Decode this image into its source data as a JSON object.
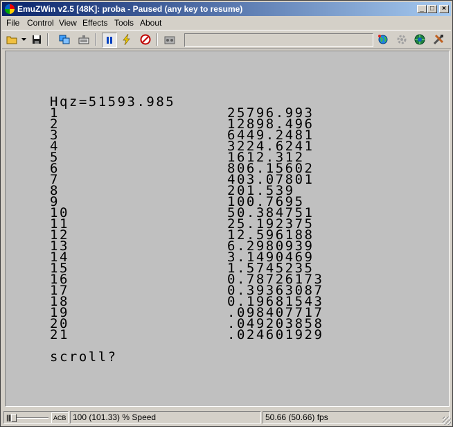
{
  "window": {
    "title": "EmuZWin v2.5 [48K]: proba - Paused (any key to resume)",
    "controls": {
      "minimize": "_",
      "maximize": "□",
      "close": "×"
    }
  },
  "menu": [
    "File",
    "Control",
    "View",
    "Effects",
    "Tools",
    "About"
  ],
  "toolbar": {
    "icons": [
      "open-folder-icon",
      "dropdown-arrow-icon",
      "save-disk-icon",
      "snapshot-icon",
      "keyboard-icon",
      "pause-icon",
      "lightning-icon",
      "no-sound-icon",
      "tape-icon",
      "speed-field",
      "web-icon",
      "gear-icon",
      "globe-icon",
      "tools-icon"
    ]
  },
  "screen": {
    "header": "Hqz=51593.985",
    "rows": [
      {
        "n": "1",
        "v": "25796.993"
      },
      {
        "n": "2",
        "v": "12898.496"
      },
      {
        "n": "3",
        "v": "6449.2481"
      },
      {
        "n": "4",
        "v": "3224.6241"
      },
      {
        "n": "5",
        "v": "1612.312"
      },
      {
        "n": "6",
        "v": "806.15602"
      },
      {
        "n": "7",
        "v": "403.07801"
      },
      {
        "n": "8",
        "v": "201.539"
      },
      {
        "n": "9",
        "v": "100.7695"
      },
      {
        "n": "10",
        "v": "50.384751"
      },
      {
        "n": "11",
        "v": "25.192375"
      },
      {
        "n": "12",
        "v": "12.596188"
      },
      {
        "n": "13",
        "v": "6.2980939"
      },
      {
        "n": "14",
        "v": "3.1490469"
      },
      {
        "n": "15",
        "v": "1.5745235"
      },
      {
        "n": "16",
        "v": "0.78726173"
      },
      {
        "n": "17",
        "v": "0.39363087"
      },
      {
        "n": "18",
        "v": "0.19681543"
      },
      {
        "n": "19",
        "v": ".098407717"
      },
      {
        "n": "20",
        "v": ".049203858"
      },
      {
        "n": "21",
        "v": ".024601929"
      }
    ],
    "prompt": "scroll?"
  },
  "statusbar": {
    "acb_label": "ACB",
    "speed": "100 (101.33) % Speed",
    "fps": "50.66 (50.66) fps"
  }
}
